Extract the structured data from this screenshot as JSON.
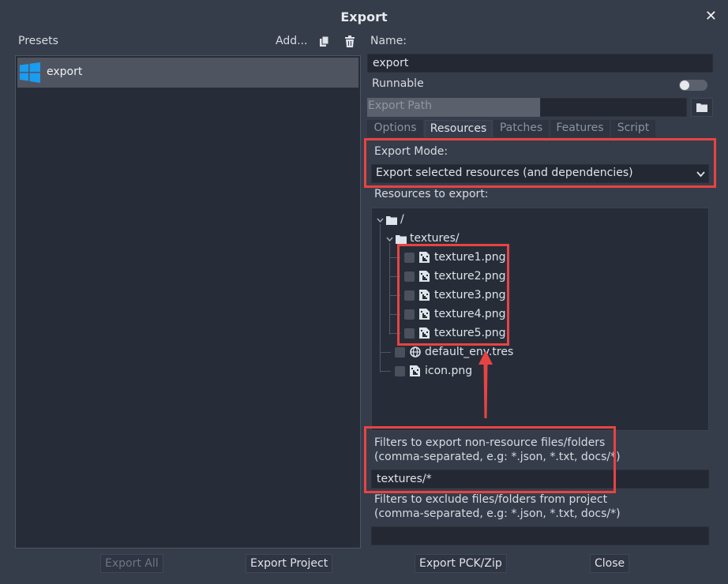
{
  "window": {
    "title": "Export"
  },
  "presets": {
    "label": "Presets",
    "add_label": "Add...",
    "items": [
      {
        "name": "export"
      }
    ]
  },
  "name_section": {
    "label": "Name:",
    "value": "export"
  },
  "runnable": {
    "label": "Runnable",
    "enabled": false
  },
  "export_path": {
    "label": "Export Path",
    "value": ""
  },
  "tabs": [
    {
      "label": "Options",
      "active": false
    },
    {
      "label": "Resources",
      "active": true
    },
    {
      "label": "Patches",
      "active": false
    },
    {
      "label": "Features",
      "active": false
    },
    {
      "label": "Script",
      "active": false
    }
  ],
  "export_mode": {
    "label": "Export Mode:",
    "value": "Export selected resources (and dependencies)"
  },
  "resources": {
    "label": "Resources to export:",
    "root": "/",
    "folder": "textures/",
    "textures": [
      "texture1.png",
      "texture2.png",
      "texture3.png",
      "texture4.png",
      "texture5.png"
    ],
    "others": [
      "default_env.tres",
      "icon.png"
    ]
  },
  "include_filters": {
    "label_line1": "Filters to export non-resource files/folders",
    "label_line2": "(comma-separated, e.g: *.json, *.txt, docs/*)",
    "value": "textures/*"
  },
  "exclude_filters": {
    "label_line1": "Filters to exclude files/folders from project",
    "label_line2": "(comma-separated, e.g: *.json, *.txt, docs/*)",
    "value": ""
  },
  "footer": {
    "export_all": "Export All",
    "export_project": "Export Project",
    "export_pck": "Export PCK/Zip",
    "close": "Close"
  },
  "colors": {
    "highlight": "#e84343",
    "windows_logo": "#1a9cf0",
    "accent": "#4f5461"
  }
}
